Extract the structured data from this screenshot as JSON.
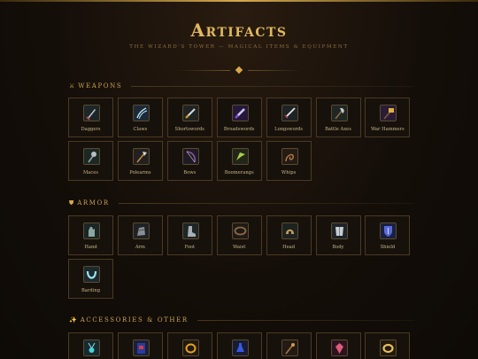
{
  "header": {
    "title": "Artifacts",
    "subtitle": "THE WIZARD'S TOWER — MAGICAL ITEMS & EQUIPMENT"
  },
  "sections": {
    "weapons": {
      "icon": "crossed-swords-icon",
      "title": "WEAPONS",
      "items": [
        {
          "label": "Daggers",
          "icon": "dagger-icon"
        },
        {
          "label": "Claws",
          "icon": "claw-icon"
        },
        {
          "label": "Shortswords",
          "icon": "shortsword-icon"
        },
        {
          "label": "Broadswords",
          "icon": "broadsword-icon"
        },
        {
          "label": "Longswords",
          "icon": "longsword-icon"
        },
        {
          "label": "Battle Axes",
          "icon": "battle-axe-icon"
        },
        {
          "label": "War Hammers",
          "icon": "war-hammer-icon"
        },
        {
          "label": "Maces",
          "icon": "mace-icon"
        },
        {
          "label": "Polearms",
          "icon": "polearm-icon"
        },
        {
          "label": "Bows",
          "icon": "bow-icon"
        },
        {
          "label": "Boomerangs",
          "icon": "boomerang-icon"
        },
        {
          "label": "Whips",
          "icon": "whip-icon"
        }
      ]
    },
    "armor": {
      "icon": "shield-icon",
      "title": "ARMOR",
      "items": [
        {
          "label": "Hand",
          "icon": "gauntlet-icon"
        },
        {
          "label": "Arm",
          "icon": "arm-guard-icon"
        },
        {
          "label": "Foot",
          "icon": "boot-icon"
        },
        {
          "label": "Waist",
          "icon": "belt-icon"
        },
        {
          "label": "Head",
          "icon": "helmet-icon"
        },
        {
          "label": "Body",
          "icon": "breastplate-icon"
        },
        {
          "label": "Shield",
          "icon": "shield-icon"
        },
        {
          "label": "Barding",
          "icon": "horseshoe-icon"
        }
      ]
    },
    "accessories": {
      "icon": "sparkles-icon",
      "title": "ACCESSORIES & OTHER",
      "items": [
        {
          "label": "",
          "icon": "amulet-icon"
        },
        {
          "label": "",
          "icon": "tome-icon"
        },
        {
          "label": "",
          "icon": "ring-icon"
        },
        {
          "label": "",
          "icon": "potion-icon"
        },
        {
          "label": "",
          "icon": "staff-icon"
        },
        {
          "label": "",
          "icon": "gem-icon"
        },
        {
          "label": "",
          "icon": "gold-ring-icon"
        }
      ]
    }
  },
  "colors": {
    "background": "#110c08",
    "accent": "#d4a94a",
    "title": "#e0b85e",
    "tile_border": "#4a3a22",
    "label": "#c8b48a"
  }
}
